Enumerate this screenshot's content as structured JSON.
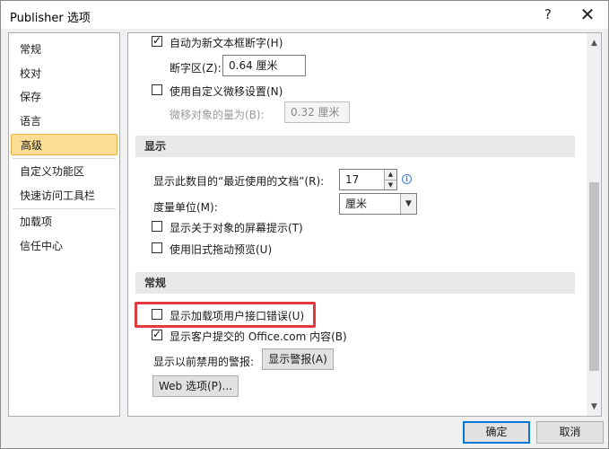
{
  "window": {
    "title": "Publisher 选项",
    "help_glyph": "?",
    "close_glyph": "✕"
  },
  "sidebar": {
    "items": [
      {
        "label": "常规",
        "active": false
      },
      {
        "label": "校对",
        "active": false
      },
      {
        "label": "保存",
        "active": false
      },
      {
        "label": "语言",
        "active": false
      },
      {
        "label": "高级",
        "active": true
      },
      {
        "label": "自定义功能区",
        "active": false
      },
      {
        "label": "快速访问工具栏",
        "active": false
      },
      {
        "label": "加载项",
        "active": false
      },
      {
        "label": "信任中心",
        "active": false
      }
    ]
  },
  "editing": {
    "auto_hyphenate": {
      "label": "自动为新文本框断字(H)",
      "checked": true
    },
    "hyphen_zone": {
      "label": "断字区(Z):",
      "value": "0.64 厘米"
    },
    "custom_nudge": {
      "label": "使用自定义微移设置(N)",
      "checked": false
    },
    "nudge_amount": {
      "label": "微移对象的量为(B):",
      "value": "0.32 厘米"
    }
  },
  "display": {
    "header": "显示",
    "recent_docs": {
      "label": "显示此数目的“最近使用的文档”(R):",
      "value": "17"
    },
    "units": {
      "label": "度量单位(M):",
      "value": "厘米"
    },
    "screentips": {
      "label": "显示关于对象的屏幕提示(T)",
      "checked": false
    },
    "legacy_drag": {
      "label": "使用旧式拖动预览(U)",
      "checked": false
    }
  },
  "general": {
    "header": "常规",
    "addin_errors": {
      "label": "显示加载项用户接口错误(U)",
      "checked": false
    },
    "office_content": {
      "label": "显示客户提交的 Office.com 内容(B)",
      "checked": true
    },
    "disabled_alerts": {
      "label": "显示以前禁用的警报:",
      "button": "显示警报(A)"
    },
    "web_options_button": "Web 选项(P)..."
  },
  "footer": {
    "ok": "确定",
    "cancel": "取消"
  },
  "scrollbar": {
    "up_glyph": "▲",
    "down_glyph": "▼"
  },
  "colors": {
    "highlight_border": "#e0393e",
    "active_nav_bg": "#fcde92",
    "info_icon": "#3a7bd5"
  }
}
